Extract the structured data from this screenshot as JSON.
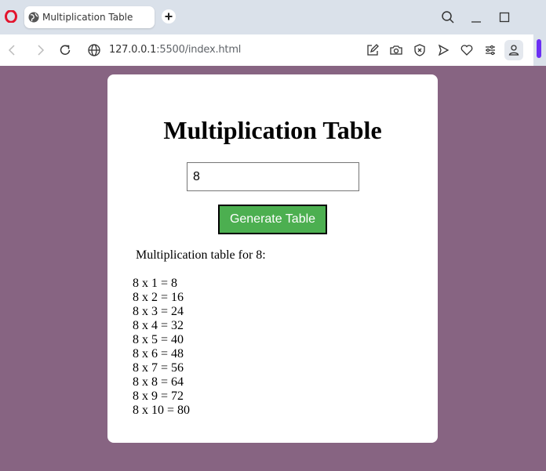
{
  "browser": {
    "tab_title": "Multiplication Table",
    "url_host": "127.0.0.1",
    "url_rest": ":5500/index.html",
    "icons": [
      "opera-logo-icon",
      "globe-favicon-icon",
      "plus-icon",
      "search-icon",
      "minimize-icon",
      "maximize-icon",
      "back-icon",
      "forward-icon",
      "reload-icon",
      "site-info-icon",
      "edit-icon",
      "camera-icon",
      "shield-icon",
      "send-icon",
      "heart-icon",
      "easy-setup-icon",
      "profile-icon"
    ]
  },
  "page": {
    "title": "Multiplication Table",
    "input_value": "8",
    "button_label": "Generate Table",
    "result_heading": "Multiplication table for 8:",
    "results": [
      "8 x 1 = 8",
      "8 x 2 = 16",
      "8 x 3 = 24",
      "8 x 4 = 32",
      "8 x 5 = 40",
      "8 x 6 = 48",
      "8 x 7 = 56",
      "8 x 8 = 64",
      "8 x 9 = 72",
      "8 x 10 = 80"
    ]
  },
  "colors": {
    "background": "#876482",
    "button": "#4caf50",
    "opera_red": "#e3142d",
    "accent": "#6b2ff4"
  }
}
